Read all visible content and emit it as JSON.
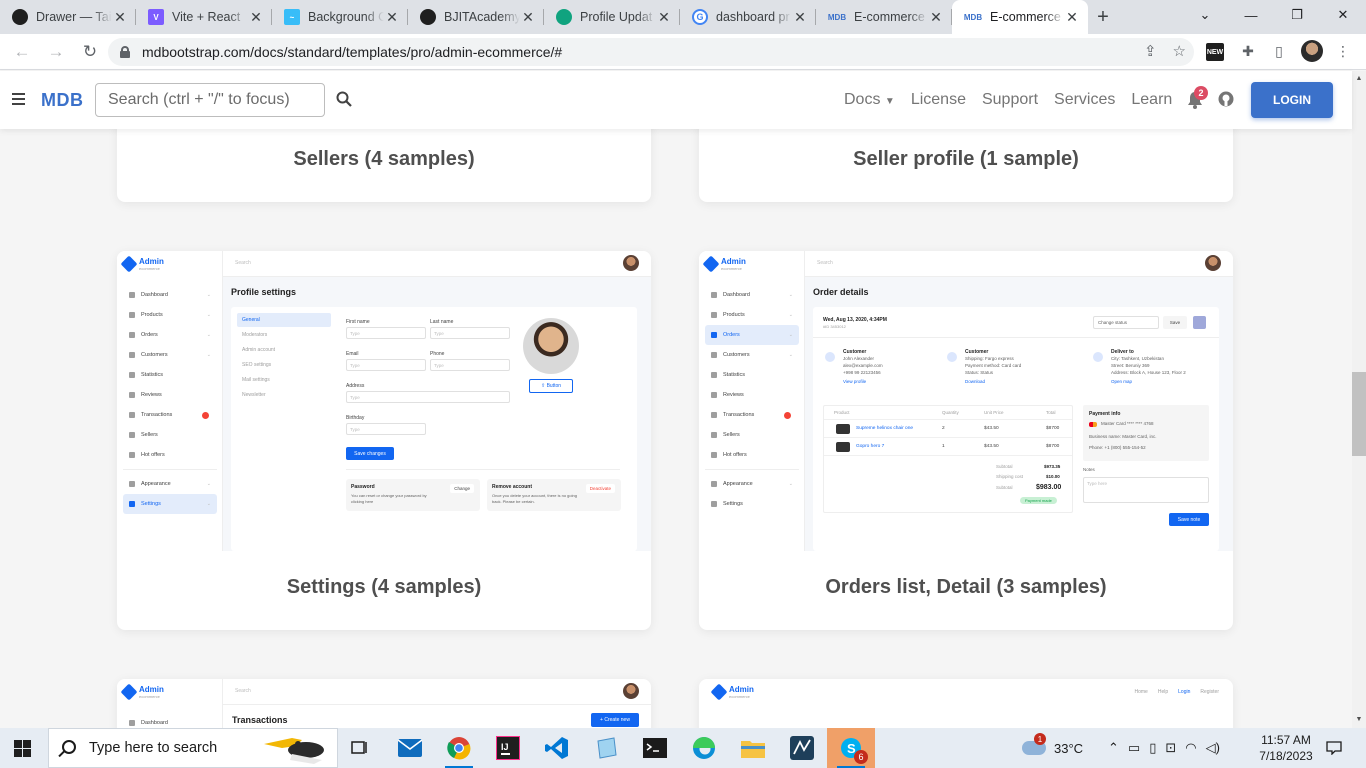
{
  "browser": {
    "tabs": [
      {
        "title": "Drawer — Tai",
        "icon": "tailwind-site-favicon",
        "color": "#1f1f1f"
      },
      {
        "title": "Vite + React",
        "icon": "vite-favicon",
        "color": "#7c5cff"
      },
      {
        "title": "Background C",
        "icon": "tailwind-favicon",
        "color": "#38bdf8"
      },
      {
        "title": "BJITAcademy:",
        "icon": "github-favicon",
        "color": "#1f1f1f"
      },
      {
        "title": "Profile Updat",
        "icon": "chatgpt-favicon",
        "color": "#10a37f"
      },
      {
        "title": "dashboard pr",
        "icon": "google-favicon",
        "color": "#4285f4"
      },
      {
        "title": "E-commerce",
        "icon": "mdb-favicon",
        "color": "#3b71ca"
      },
      {
        "title": "E-commerce",
        "icon": "mdb-favicon",
        "color": "#3b71ca",
        "active": true
      }
    ],
    "url": "mdbootstrap.com/docs/standard/templates/pro/admin-ecommerce/#"
  },
  "mdb_nav": {
    "logo": "MDB",
    "search_placeholder": "Search (ctrl + \"/\" to focus)",
    "links": [
      "Docs",
      "License",
      "Support",
      "Services",
      "Learn"
    ],
    "notification_count": "2",
    "login_label": "LOGIN"
  },
  "cards": {
    "sellers": "Sellers (4 samples)",
    "seller_profile": "Seller profile (1 sample)",
    "settings": "Settings (4 samples)",
    "orders": "Orders list, Detail (3 samples)"
  },
  "preview_common": {
    "logo": "Admin",
    "logo_sub": "ecommerce",
    "search": "Search",
    "menu": [
      "Dashboard",
      "Products",
      "Orders",
      "Customers",
      "Statistics",
      "Reviews",
      "Transactions",
      "Sellers",
      "Hot offers",
      "Appearance",
      "Settings"
    ]
  },
  "settings_preview": {
    "title": "Profile settings",
    "tabs": [
      "General",
      "Moderators",
      "Admin account",
      "SEO settings",
      "Mail settings",
      "Newsletter"
    ],
    "first_name": "First name",
    "last_name": "Last name",
    "email": "Email",
    "phone": "Phone",
    "address": "Address",
    "birthday": "Birthday",
    "placeholder": "Type",
    "save": "Save changes",
    "upload": "Button",
    "password_title": "Password",
    "password_text": "You can reset or change your password by clicking here",
    "change": "Change",
    "remove_title": "Remove account",
    "remove_text": "Once you delete your account, there is no going back. Please be certain.",
    "deactivate": "Deactivate"
  },
  "orders_preview": {
    "title": "Order details",
    "date": "Wed, Aug 13, 2020, 4:34PM",
    "order_id": "#ID 3453012",
    "change_status": "Change status",
    "save": "Save",
    "customer_h": "Customer",
    "customer_lines": [
      "John Alexander",
      "alex@example.com",
      "+998 99 22123456",
      "View profile"
    ],
    "shipping_h": "Customer",
    "shipping_lines": [
      "Shipping: Fargo express",
      "Payment method: Card card",
      "Status: Status",
      "Download"
    ],
    "deliver_h": "Deliver to",
    "deliver_lines": [
      "City: Tashkent, Uzbekistan",
      "Street: Beruniy 369",
      "Address: Block A, House 123, Floor 2",
      "Open map"
    ],
    "table_head": [
      "Product",
      "Quantity",
      "Unit Price",
      "Total"
    ],
    "rows": [
      {
        "product": "Supreme helinox chair one",
        "qty": "2",
        "price": "$43.50",
        "total": "$8700"
      },
      {
        "product": "Gopro hero 7",
        "qty": "1",
        "price": "$43.50",
        "total": "$8700"
      }
    ],
    "subtotal_label": "Subtotal",
    "subtotal": "$973.35",
    "shipping_label": "Shipping cost",
    "shipping": "$10.00",
    "grand_label": "Subtotal",
    "grand": "$983.00",
    "payment_made": "Payment made",
    "payment_info_h": "Payment info",
    "payment_lines": [
      "Master Card **** **** 4768",
      "Business name: Master Card, inc.",
      "Phone: +1 (800) 555-154-52"
    ],
    "notes": "Notes",
    "notes_placeholder": "Type here",
    "save_note": "Save note"
  },
  "bottom_previews": {
    "transactions_title": "Transactions",
    "create_new": "+ Create new",
    "home": "Home",
    "help": "Help",
    "login": "Login",
    "register": "Register"
  },
  "taskbar": {
    "search": "Type here to search",
    "temperature": "33°C",
    "weather_badge": "1",
    "skype_badge": "6",
    "time": "11:57 AM",
    "date": "7/18/2023"
  }
}
